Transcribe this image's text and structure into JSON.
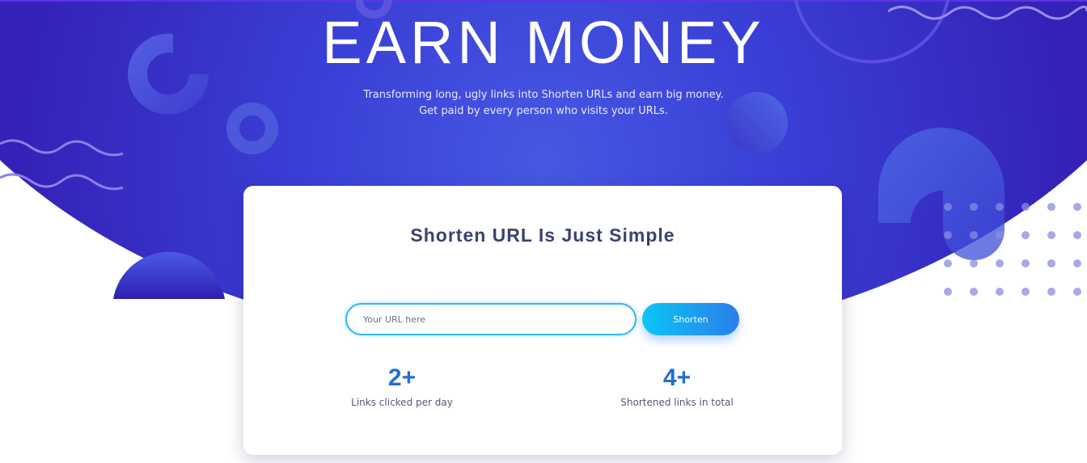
{
  "hero": {
    "title": "EARN MONEY",
    "subtitle_line1": "Transforming long, ugly links into Shorten URLs and earn big money.",
    "subtitle_line2": "Get paid by every person who visits your URLs."
  },
  "card": {
    "title": "Shorten URL Is Just Simple",
    "url_input": {
      "value": "",
      "placeholder": "Your URL here"
    },
    "shorten_label": "Shorten"
  },
  "stats": [
    {
      "value": "2+",
      "label": "Links clicked per day"
    },
    {
      "value": "4+",
      "label": "Shortened links in total"
    }
  ],
  "colors": {
    "hero_dark": "#3312a8",
    "hero_light": "#4658e3",
    "accent_blue": "#1f6fd6",
    "button_start": "#0cc5f6",
    "button_end": "#2a7ee9",
    "card_title": "#3b4270"
  }
}
